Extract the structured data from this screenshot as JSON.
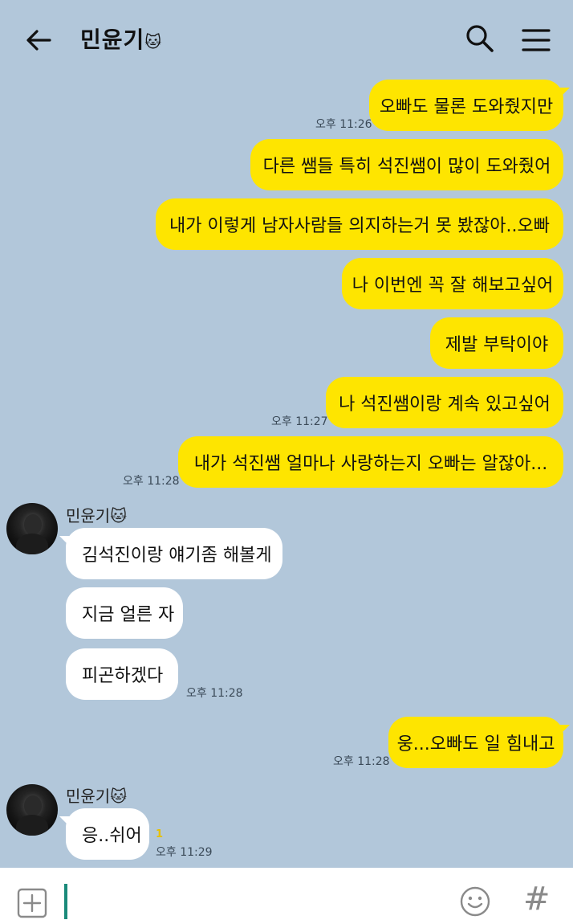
{
  "header": {
    "title": "민윤기",
    "title_emoji": "🐱"
  },
  "messages": [
    {
      "text": "오빠도 물론 도와줬지만",
      "time": "오후 11:26"
    },
    {
      "text": "다른 쌤들 특히 석진쌤이 많이 도와줬어"
    },
    {
      "text": "내가 이렇게 남자사람들 의지하는거 못 봤잖아..오빠"
    },
    {
      "text": "나 이번엔 꼭 잘 해보고싶어"
    },
    {
      "text": "제발 부탁이야"
    },
    {
      "text": "나 석진쌤이랑 계속 있고싶어",
      "time": "오후 11:27"
    },
    {
      "text": "내가 석진쌤 얼마나 사랑하는지 오빠는 알잖아...",
      "time": "오후 11:28"
    },
    {
      "sender": "민윤기",
      "text": "김석진이랑 얘기좀 해볼게"
    },
    {
      "text": "지금 얼른 자"
    },
    {
      "text": "피곤하겠다",
      "time": "오후 11:28"
    },
    {
      "text": "웅...오빠도 일 힘내고",
      "time": "오후 11:28"
    },
    {
      "sender": "민윤기",
      "text": "응..쉬어",
      "time": "오후 11:29",
      "unread": "1"
    }
  ],
  "input": {
    "hash_symbol": "#"
  },
  "colors": {
    "background": "#b2c7da",
    "my_bubble": "#fee500",
    "their_bubble": "#ffffff"
  }
}
